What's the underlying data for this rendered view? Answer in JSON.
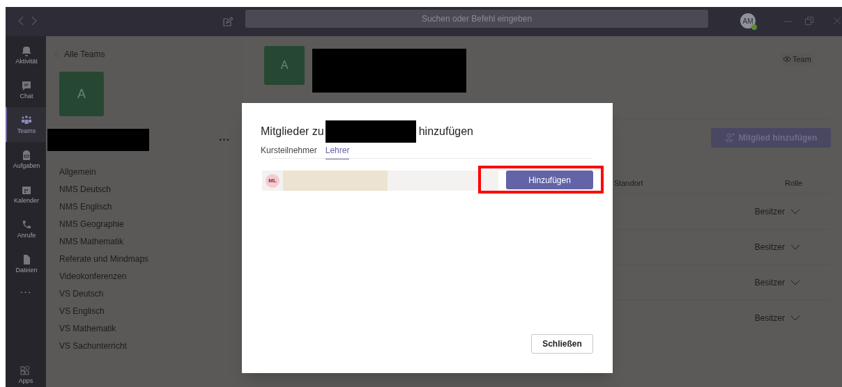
{
  "title_bar": {
    "search": {
      "placeholder": "Suchen oder Befehl eingeben"
    },
    "avatar": "AM"
  },
  "rail": [
    {
      "label": "Aktivität",
      "selected": false
    },
    {
      "label": "Chat",
      "selected": false
    },
    {
      "label": "Teams",
      "selected": true
    },
    {
      "label": "Aufgaben",
      "selected": false
    },
    {
      "label": "Kalender",
      "selected": false
    },
    {
      "label": "Anrufe",
      "selected": false
    },
    {
      "label": "Dateien",
      "selected": false
    }
  ],
  "rail_more": "···",
  "rail_apps": "Apps",
  "sidebar": {
    "back": "Alle Teams",
    "avatar": "A",
    "more": "···",
    "channels": [
      "Allgemein",
      "NMS Deutsch",
      "NMS Englisch",
      "NMS Geographie",
      "NMS Mathematik",
      "Referate und Mindmaps",
      "Videokonferenzen",
      "VS Deutsch",
      "VS Englisch",
      "VS Mathematik",
      "VS Sachunterricht"
    ]
  },
  "team_header": {
    "avatar": "A",
    "view_badge": "Team",
    "add_member_button": "Mitglied hinzufügen",
    "columns": [
      "Standort",
      "Rolle"
    ],
    "rows": [
      {
        "role": "Besitzer"
      },
      {
        "role": "Besitzer"
      },
      {
        "role": "Besitzer"
      },
      {
        "role": "Besitzer"
      }
    ]
  },
  "dialog": {
    "title_prefix": "Mitglieder zu",
    "title_suffix": "hinzufügen",
    "tabs": [
      {
        "label": "Kursteilnehmer",
        "selected": false
      },
      {
        "label": "Lehrer",
        "selected": true
      }
    ],
    "members": [
      {
        "initials": "ML"
      }
    ],
    "add_button": "Hinzufügen",
    "close_button": "Schließen"
  }
}
